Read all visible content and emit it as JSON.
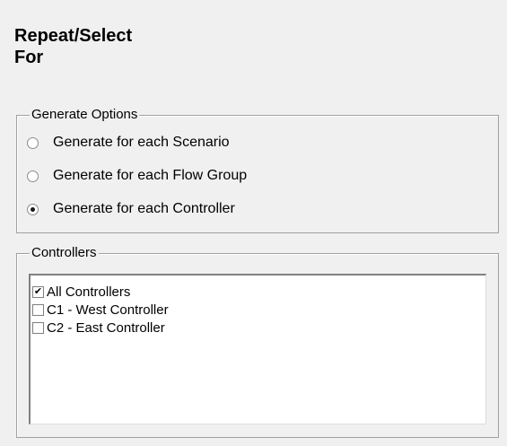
{
  "title_line1": "Repeat/Select",
  "title_line2": "For",
  "generate_options": {
    "label": "Generate Options",
    "options": [
      {
        "label": "Generate for each Scenario",
        "selected": false
      },
      {
        "label": "Generate for each Flow Group",
        "selected": false
      },
      {
        "label": "Generate for each Controller",
        "selected": true
      }
    ]
  },
  "controllers": {
    "label": "Controllers",
    "items": [
      {
        "label": "All Controllers",
        "checked": true
      },
      {
        "label": "C1 - West Controller",
        "checked": false
      },
      {
        "label": "C2 - East Controller",
        "checked": false
      }
    ]
  }
}
